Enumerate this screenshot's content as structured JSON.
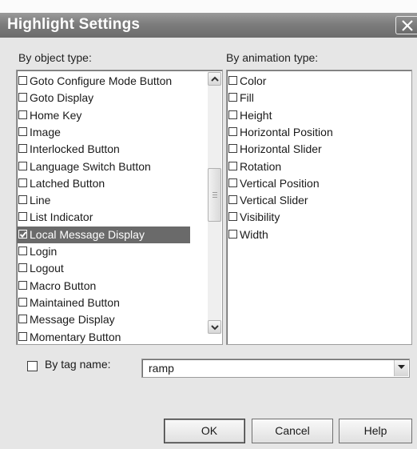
{
  "window": {
    "title": "Highlight Settings"
  },
  "object_type": {
    "label": "By object type:",
    "items": [
      {
        "label": "Goto Configure Mode Button",
        "checked": false
      },
      {
        "label": "Goto Display",
        "checked": false
      },
      {
        "label": "Home Key",
        "checked": false
      },
      {
        "label": "Image",
        "checked": false
      },
      {
        "label": "Interlocked Button",
        "checked": false
      },
      {
        "label": "Language Switch Button",
        "checked": false
      },
      {
        "label": "Latched Button",
        "checked": false
      },
      {
        "label": "Line",
        "checked": false
      },
      {
        "label": "List Indicator",
        "checked": false
      },
      {
        "label": "Local Message Display",
        "checked": true,
        "selected": true
      },
      {
        "label": "Login",
        "checked": false
      },
      {
        "label": "Logout",
        "checked": false
      },
      {
        "label": "Macro Button",
        "checked": false
      },
      {
        "label": "Maintained Button",
        "checked": false
      },
      {
        "label": "Message Display",
        "checked": false
      },
      {
        "label": "Momentary Button",
        "checked": false
      }
    ]
  },
  "animation_type": {
    "label": "By animation type:",
    "items": [
      {
        "label": "Color",
        "checked": false
      },
      {
        "label": "Fill",
        "checked": false
      },
      {
        "label": "Height",
        "checked": false
      },
      {
        "label": "Horizontal Position",
        "checked": false
      },
      {
        "label": "Horizontal Slider",
        "checked": false
      },
      {
        "label": "Rotation",
        "checked": false
      },
      {
        "label": "Vertical Position",
        "checked": false
      },
      {
        "label": "Vertical Slider",
        "checked": false
      },
      {
        "label": "Visibility",
        "checked": false
      },
      {
        "label": "Width",
        "checked": false
      }
    ]
  },
  "tag_name": {
    "label": "By tag name:",
    "checked": false,
    "value": "ramp"
  },
  "buttons": {
    "ok": "OK",
    "cancel": "Cancel",
    "help": "Help"
  },
  "colors": {
    "selection": "#6a6a6a",
    "titlebar": "#7d7d7d",
    "dialog_bg": "#e6e6e6"
  }
}
